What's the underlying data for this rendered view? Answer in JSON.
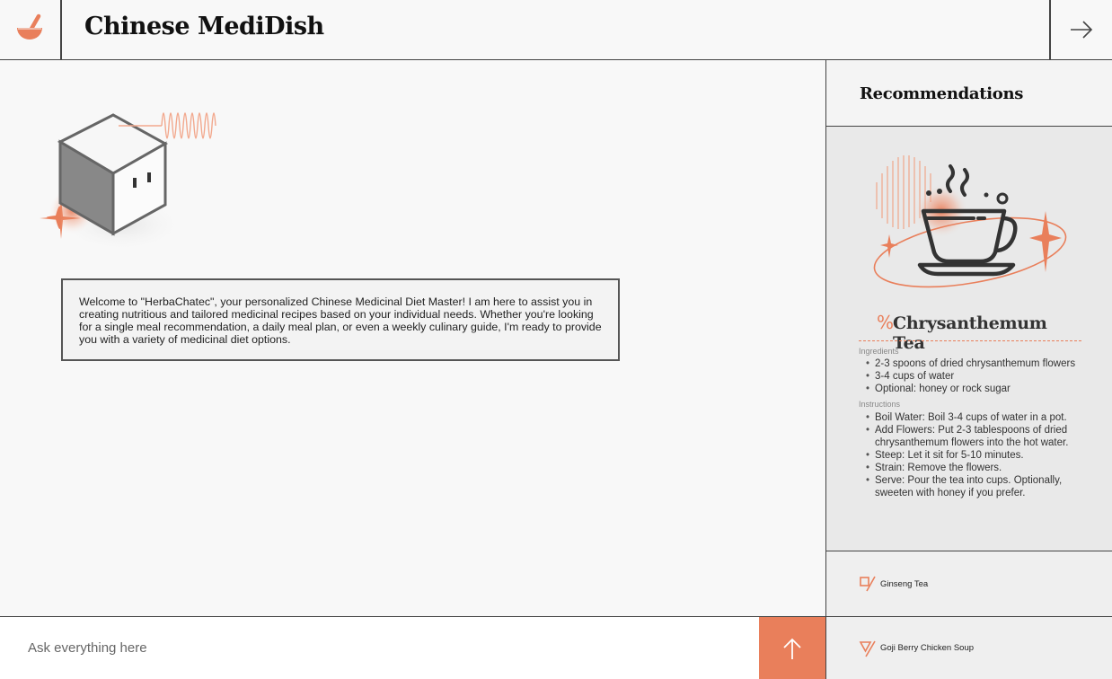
{
  "header": {
    "logo_icon": "mortar-bowl-icon",
    "title": "Chinese MediDish",
    "next_icon": "arrow-right-icon"
  },
  "chat": {
    "bot_avatar_icon": "cube-bot-icon",
    "welcome_message": "Welcome to \"HerbaChatec\", your personalized Chinese Medicinal Diet Master! I am here to assist you in creating nutritious and tailored medicinal recipes based on your individual needs. Whether you're looking for a single meal recommendation, a daily meal plan, or even a weekly culinary guide, I'm ready to provide you with a variety of medicinal diet options."
  },
  "input": {
    "placeholder": "Ask everything here",
    "value": "",
    "send_icon": "arrow-up-icon"
  },
  "recommendations": {
    "title": "Recommendations",
    "featured": {
      "image_icon": "tea-cup-icon",
      "mark": "%",
      "name": "Chrysanthemum Tea",
      "ingredients_label": "Ingredients",
      "ingredients": [
        "2-3 spoons of dried chrysanthemum flowers",
        "3-4 cups of water",
        "Optional: honey or rock sugar"
      ],
      "instructions_label": "Instructions",
      "instructions": [
        "Boil Water: Boil 3-4 cups of water in a pot.",
        "Add Flowers: Put 2-3 tablespoons of dried chrysanthemum flowers into the hot water.",
        "Steep: Let it sit for 5-10 minutes.",
        "Strain: Remove the flowers.",
        "Serve: Pour the tea into cups. Optionally, sweeten with honey if you prefer."
      ]
    },
    "items": [
      {
        "label": "Ginseng Tea",
        "icon": "square-slash-icon"
      },
      {
        "label": "Goji Berry Chicken Soup",
        "icon": "triangle-slash-icon"
      }
    ]
  },
  "colors": {
    "accent": "#e97f5b",
    "border": "#444444",
    "background": "#f8f8f8",
    "card": "#e9e9e9"
  }
}
